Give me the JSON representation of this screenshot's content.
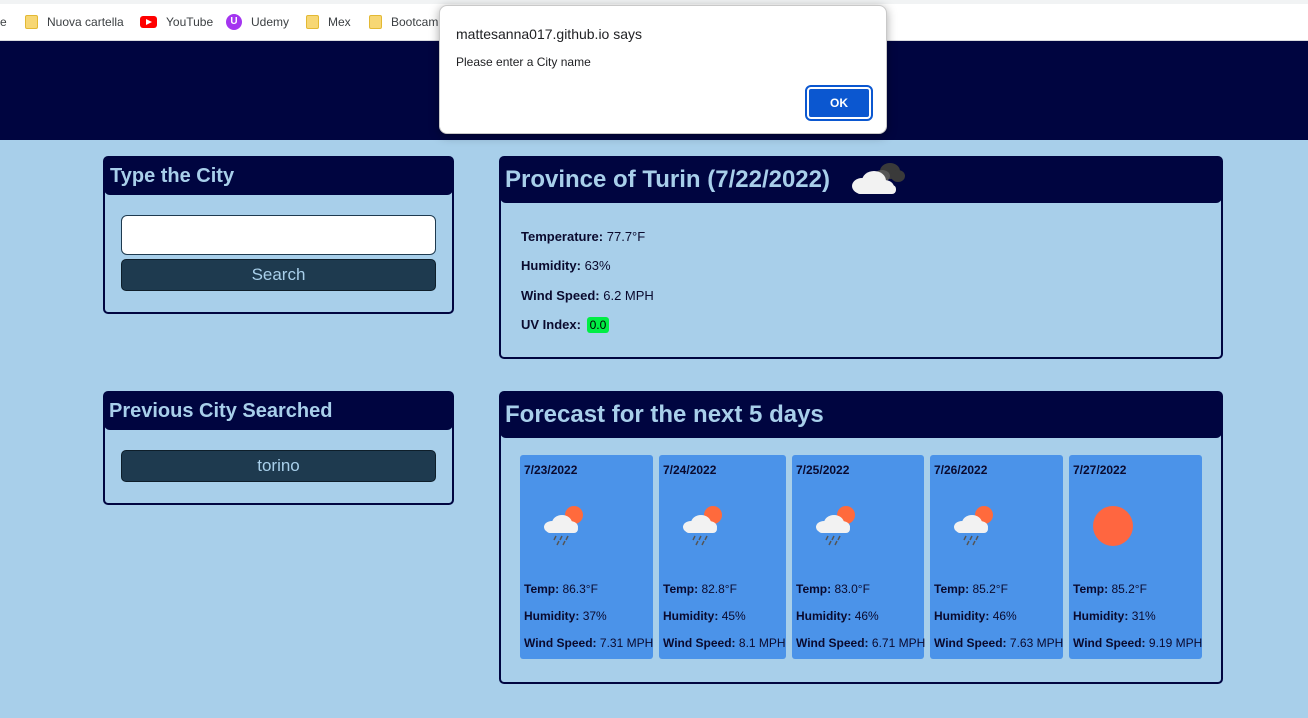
{
  "bookmarks": [
    {
      "label": "e",
      "icon": "none"
    },
    {
      "label": "Nuova cartella",
      "icon": "folder-icon"
    },
    {
      "label": "YouTube",
      "icon": "youtube-icon"
    },
    {
      "label": "Udemy",
      "icon": "udemy-icon"
    },
    {
      "label": "Mex",
      "icon": "folder-icon"
    },
    {
      "label": "Bootcam",
      "icon": "folder-icon"
    }
  ],
  "search": {
    "title": "Type the City",
    "input_value": "",
    "button_label": "Search"
  },
  "history": {
    "title": "Previous City Searched",
    "items": [
      "torino"
    ]
  },
  "current": {
    "title": "Province of Turin (7/22/2022)",
    "icon": "cloudy-icon",
    "temperature_label": "Temperature:",
    "temperature": "77.7°F",
    "humidity_label": "Humidity:",
    "humidity": "63%",
    "wind_label": "Wind Speed:",
    "wind": "6.2 MPH",
    "uv_label": "UV Index:",
    "uv": "0.0",
    "uv_color": "#00ee44"
  },
  "forecast": {
    "title": "Forecast for the next 5 days",
    "temp_label": "Temp:",
    "humidity_label": "Humidity:",
    "wind_label": "Wind Speed:",
    "days": [
      {
        "date": "7/23/2022",
        "icon": "rain-icon",
        "temp": "86.3°F",
        "humidity": "37%",
        "wind": "7.31 MPH"
      },
      {
        "date": "7/24/2022",
        "icon": "rain-icon",
        "temp": "82.8°F",
        "humidity": "45%",
        "wind": "8.1 MPH"
      },
      {
        "date": "7/25/2022",
        "icon": "rain-icon",
        "temp": "83.0°F",
        "humidity": "46%",
        "wind": "6.71 MPH"
      },
      {
        "date": "7/26/2022",
        "icon": "rain-icon",
        "temp": "85.2°F",
        "humidity": "46%",
        "wind": "7.63 MPH"
      },
      {
        "date": "7/27/2022",
        "icon": "sun-icon",
        "temp": "85.2°F",
        "humidity": "31%",
        "wind": "9.19 MPH"
      }
    ]
  },
  "dialog": {
    "title": "mattesanna017.github.io says",
    "message": "Please enter a City name",
    "ok_label": "OK"
  },
  "colors": {
    "page_bg": "#a8cfea",
    "header_bg": "#000540",
    "card_bg": "#4b93e9",
    "button_bg": "#1e3a4f",
    "dialog_button": "#0b57d0"
  }
}
